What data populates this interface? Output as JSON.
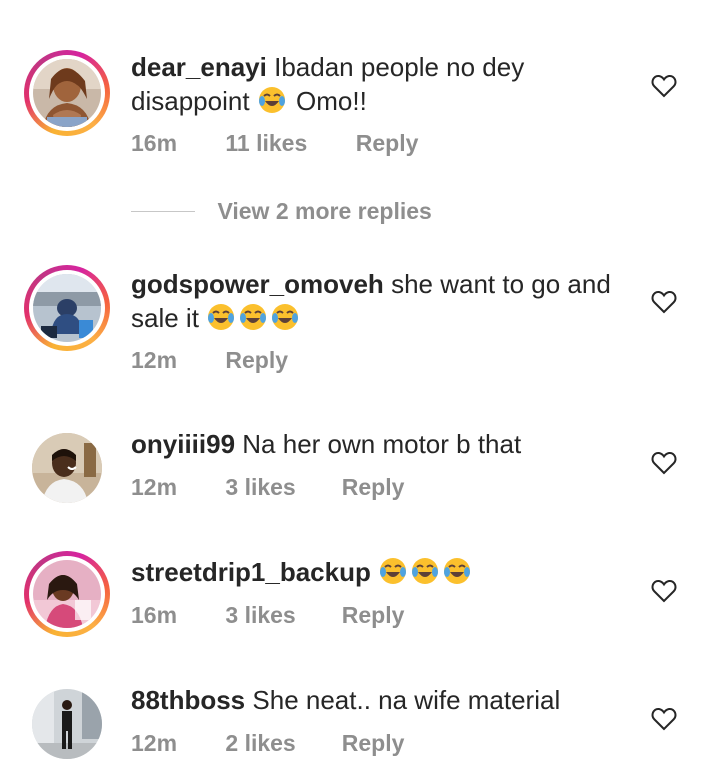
{
  "comments": [
    {
      "username": "dear_enayi",
      "text": "Ibadan people no dey disappoint",
      "text_after_emoji": "Omo!!",
      "emojis": [
        "face-with-tears-of-joy-icon"
      ],
      "time": "16m",
      "likes": "11 likes",
      "reply": "Reply",
      "story_ring": true
    },
    {
      "username": "godspower_omoveh",
      "text": "she want to go and sale it",
      "emojis": [
        "face-with-tears-of-joy-icon",
        "face-with-tears-of-joy-icon",
        "face-with-tears-of-joy-icon"
      ],
      "time": "12m",
      "likes": "",
      "reply": "Reply",
      "story_ring": true
    },
    {
      "username": "onyiiii99",
      "text": "Na her own motor b that",
      "emojis": [],
      "time": "12m",
      "likes": "3 likes",
      "reply": "Reply",
      "story_ring": false
    },
    {
      "username": "streetdrip1_backup",
      "text": "",
      "emojis": [
        "face-with-tears-of-joy-icon",
        "face-with-tears-of-joy-icon",
        "face-with-tears-of-joy-icon"
      ],
      "time": "16m",
      "likes": "3 likes",
      "reply": "Reply",
      "story_ring": true
    },
    {
      "username": "88thboss",
      "text": "She neat.. na wife material",
      "emojis": [],
      "time": "12m",
      "likes": "2 likes",
      "reply": "Reply",
      "story_ring": false
    }
  ],
  "view_more_replies": "View 2 more replies",
  "colors": {
    "text": "#262626",
    "meta": "#8e8e8e",
    "emoji_face": "#fbc02d",
    "emoji_tears": "#4fa3e0",
    "story_ring_start": "#f9b234",
    "story_ring_end": "#c13584"
  }
}
